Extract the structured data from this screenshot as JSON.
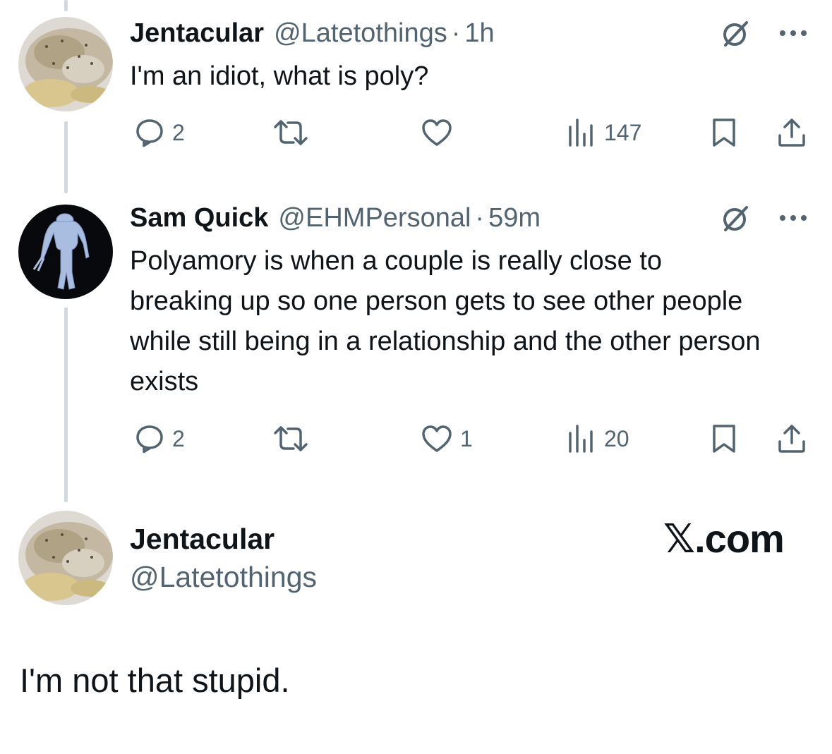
{
  "tweet1": {
    "display_name": "Jentacular",
    "handle": "@Latetothings",
    "separator": "·",
    "time": "1h",
    "text": "I'm an idiot, what is poly?",
    "reply_count": "2",
    "retweet_count": "",
    "like_count": "",
    "view_count": "147"
  },
  "tweet2": {
    "display_name": "Sam Quick",
    "handle": "@EHMPersonal",
    "separator": "·",
    "time": "59m",
    "text": "Polyamory is when a couple is really close to breaking up so one person gets to see other people while still being in a relationship and the other person exists",
    "reply_count": "2",
    "retweet_count": "",
    "like_count": "1",
    "view_count": "20"
  },
  "quote_card": {
    "display_name": "Jentacular",
    "handle": "@Latetothings",
    "brand": "𝕏.com",
    "text": "I'm not that stupid."
  },
  "icons": {
    "reply": "speech-bubble-icon",
    "retweet": "retweet-arrows-icon",
    "like": "heart-icon",
    "views": "bar-chart-icon",
    "bookmark": "bookmark-icon",
    "share": "share-upload-icon",
    "grok": "grok-slash-circle-icon",
    "more": "three-dots-icon"
  },
  "colors": {
    "text_primary": "#0f1419",
    "text_secondary": "#536471",
    "thread_line": "#cfd9de"
  }
}
